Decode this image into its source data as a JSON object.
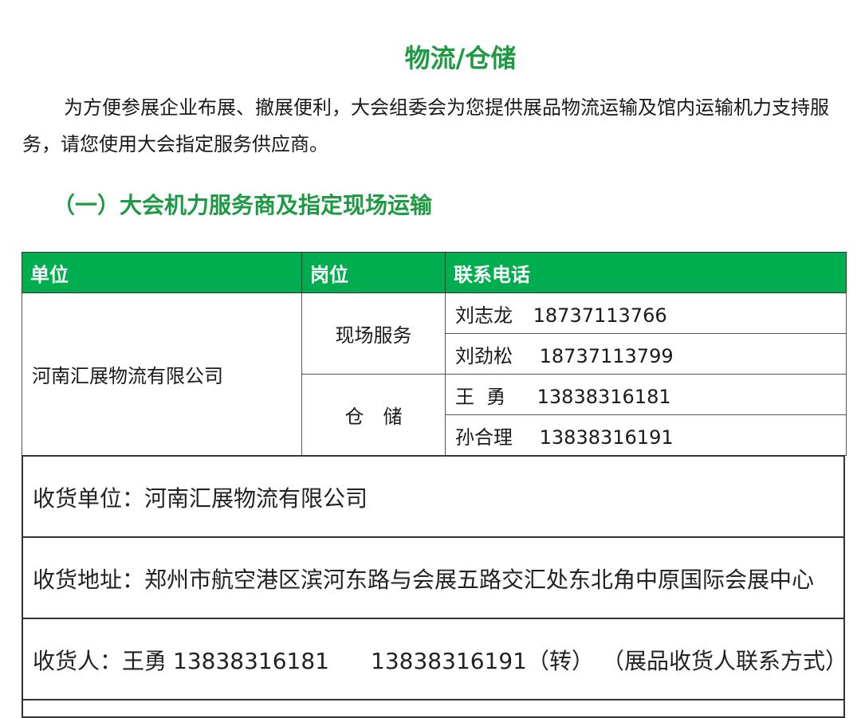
{
  "title": "物流/仓储",
  "intro": "为方便参展企业布展、撤展便利，大会组委会为您提供展品物流运输及馆内运输机力支持服务，请您使用大会指定服务供应商。",
  "section_heading": "（一）大会机力服务商及指定现场运输",
  "table": {
    "headers": [
      "单位",
      "岗位",
      "联系电话"
    ],
    "company": "河南汇展物流有限公司",
    "roles": [
      {
        "role": "现场服务",
        "contacts": [
          {
            "name": "刘志龙",
            "phone": "18737113766"
          },
          {
            "name": "刘劲松",
            "phone": "18737113799"
          }
        ]
      },
      {
        "role": "仓　储",
        "contacts": [
          {
            "name": "王  勇",
            "phone": "13838316181"
          },
          {
            "name": "孙合理",
            "phone": "13838316191"
          }
        ]
      }
    ]
  },
  "shipping": {
    "unit_label": "收货单位：",
    "unit_value": "河南汇展物流有限公司",
    "address_label": "收货地址：",
    "address_value": "郑州市航空港区滨河东路与会展五路交汇处东北角中原国际会展中心",
    "receiver_label": "收货人：",
    "receiver_name": "王勇",
    "receiver_phone1": "13838316181",
    "receiver_phone2": "13838316191（转）",
    "receiver_note": "（展品收货人联系方式）"
  }
}
